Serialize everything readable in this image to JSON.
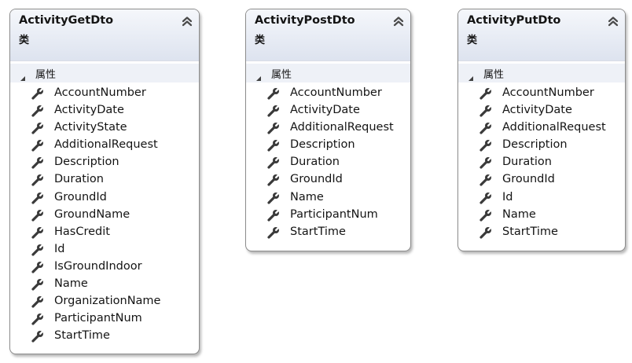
{
  "diagram": {
    "classes": [
      {
        "name": "ActivityGetDto",
        "kind": "类",
        "section_label": "属性",
        "properties": [
          "AccountNumber",
          "ActivityDate",
          "ActivityState",
          "AdditionalRequest",
          "Description",
          "Duration",
          "GroundId",
          "GroundName",
          "HasCredit",
          "Id",
          "IsGroundIndoor",
          "Name",
          "OrganizationName",
          "ParticipantNum",
          "StartTime"
        ]
      },
      {
        "name": "ActivityPostDto",
        "kind": "类",
        "section_label": "属性",
        "properties": [
          "AccountNumber",
          "ActivityDate",
          "AdditionalRequest",
          "Description",
          "Duration",
          "GroundId",
          "Name",
          "ParticipantNum",
          "StartTime"
        ]
      },
      {
        "name": "ActivityPutDto",
        "kind": "类",
        "section_label": "属性",
        "properties": [
          "AccountNumber",
          "ActivityDate",
          "AdditionalRequest",
          "Description",
          "Duration",
          "GroundId",
          "Id",
          "Name",
          "StartTime"
        ]
      }
    ],
    "icons": {
      "header_toggle": "double-chevron-up-icon",
      "section_toggle": "expanded-triangle-icon",
      "property": "wrench-icon"
    },
    "colors": {
      "header_top": "#f5f7fb",
      "header_bottom": "#dde3ef",
      "section_band": "#eef1f7",
      "border": "#8c8c8c",
      "text": "#141414",
      "icon": "#3a3a3a"
    }
  }
}
